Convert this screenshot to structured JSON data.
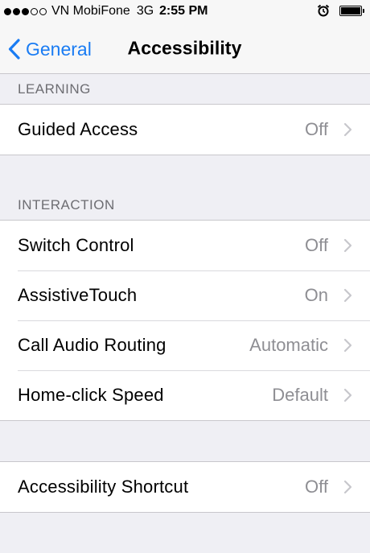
{
  "status_bar": {
    "carrier": "VN MobiFone",
    "network": "3G",
    "time": "2:55 PM",
    "signal_bars_filled": 3,
    "signal_bars_total": 5,
    "icons": [
      "alarm-icon",
      "battery-icon"
    ]
  },
  "nav": {
    "back_label": "General",
    "title": "Accessibility"
  },
  "sections": {
    "learning": {
      "header": "LEARNING",
      "items": [
        {
          "label": "Guided Access",
          "value": "Off"
        }
      ]
    },
    "interaction": {
      "header": "INTERACTION",
      "items": [
        {
          "label": "Switch Control",
          "value": "Off"
        },
        {
          "label": "AssistiveTouch",
          "value": "On"
        },
        {
          "label": "Call Audio Routing",
          "value": "Automatic"
        },
        {
          "label": "Home-click Speed",
          "value": "Default"
        }
      ]
    },
    "shortcut": {
      "items": [
        {
          "label": "Accessibility Shortcut",
          "value": "Off"
        }
      ]
    }
  },
  "colors": {
    "accent": "#1a7cf3",
    "background": "#efeff4",
    "secondary_text": "#8e8e93",
    "section_header": "#6d6d72"
  }
}
